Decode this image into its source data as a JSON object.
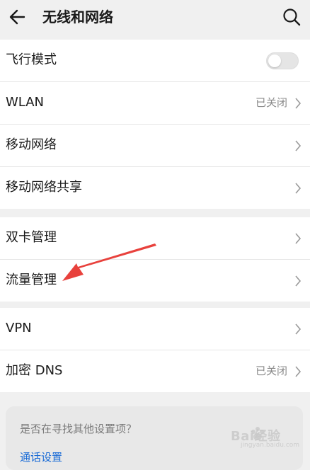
{
  "header": {
    "title": "无线和网络",
    "back_icon": "arrow-left-icon",
    "search_icon": "search-icon"
  },
  "groups": [
    {
      "items": [
        {
          "label": "飞行模式",
          "toggle": "off"
        },
        {
          "label": "WLAN",
          "status": "已关闭"
        },
        {
          "label": "移动网络"
        },
        {
          "label": "移动网络共享"
        }
      ]
    },
    {
      "items": [
        {
          "label": "双卡管理"
        },
        {
          "label": "流量管理"
        }
      ]
    },
    {
      "items": [
        {
          "label": "VPN"
        },
        {
          "label": "加密 DNS",
          "status": "已关闭"
        }
      ]
    }
  ],
  "suggestion": {
    "question": "是否在寻找其他设置项？",
    "link": "通话设置"
  },
  "annotation": {
    "color": "#e8413c"
  },
  "watermark": {
    "text": "Bai经验",
    "sub": "jingyan.baidu.com"
  }
}
